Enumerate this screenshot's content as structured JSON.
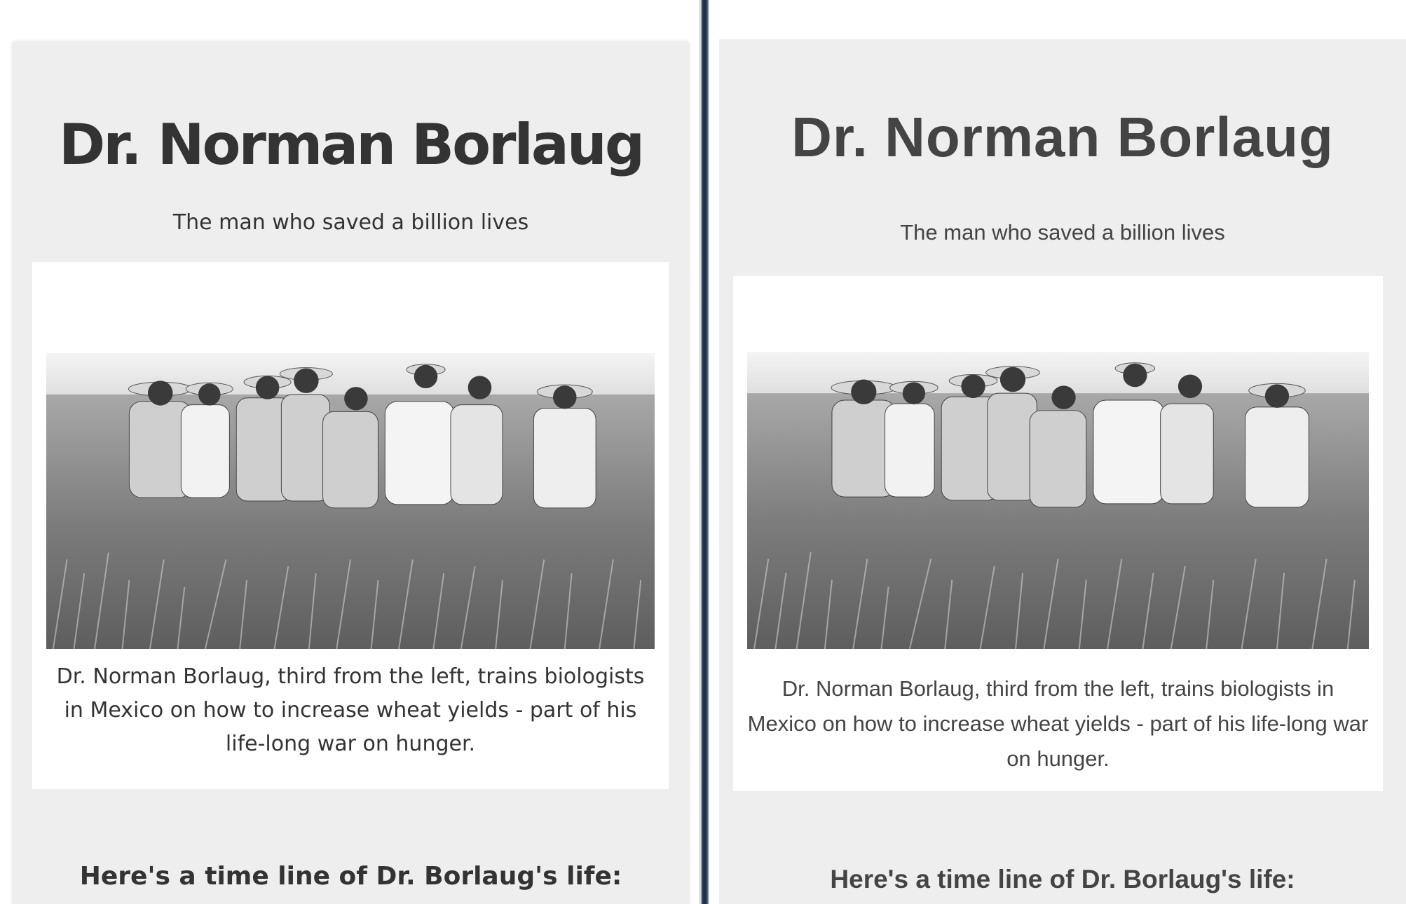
{
  "page": {
    "title": "Dr. Norman Borlaug",
    "subtitle": "The man who saved a billion lives",
    "caption": "Dr. Norman Borlaug, third from the left, trains biologists in Mexico on how to increase wheat yields - part of his life-long war on hunger.",
    "timeline_heading": "Here's a time line of Dr. Borlaug's life:"
  },
  "photo": {
    "description_icon": "photo-image",
    "style": "black-and-white"
  }
}
